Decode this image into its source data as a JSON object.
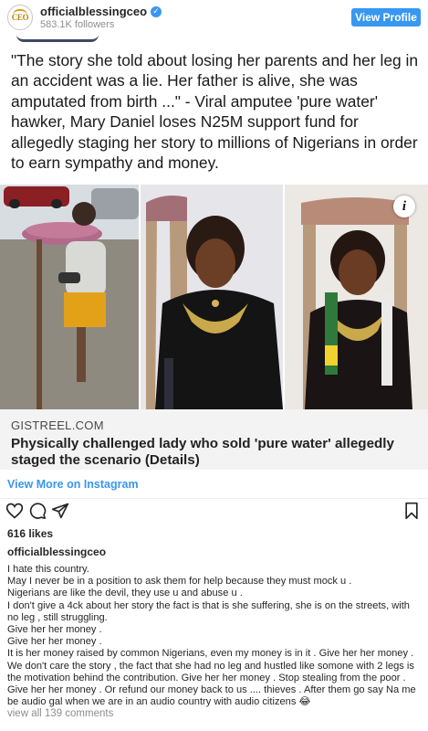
{
  "header": {
    "avatar_text": "CEO",
    "username": "officialblessingceo",
    "verified_mark": "✓",
    "followers": "583.1K followers",
    "view_profile": "View Profile"
  },
  "post": {
    "headline": "\"The story she told about losing her parents and her leg in an accident was a lie. Her father is alive, she was amputated from birth ...\" - Viral amputee 'pure water' hawker, Mary Daniel loses N25M support fund for allegedly staging her story to millions of Nigerians in order to earn sympathy and money.",
    "info_icon_glyph": "i",
    "link": {
      "domain": "GISTREEL.COM",
      "title": "Physically challenged lady who sold 'pure water' allegedly staged the scenario (Details)"
    },
    "view_more": "View More on Instagram"
  },
  "icons": {
    "like": "heart-icon",
    "comment": "comment-bubble-icon",
    "share": "paper-plane-icon",
    "save": "bookmark-icon",
    "info": "info-icon"
  },
  "engagement": {
    "likes": "616 likes",
    "caption_user": "officialblessingceo",
    "caption_lines": [
      "I hate this country.",
      "May I never be in a position to ask them for help because they must mock u .",
      "Nigerians are like the devil, they use u and abuse u .",
      "I don't give a 4ck about her story the fact is that is she suffering, she is on the streets, with no leg , still struggling.",
      "Give her her money .",
      "Give her her money .",
      "It is her money raised by common Nigerians, even my money is in it . Give her her money . We don't care the story , the fact that she had no leg and hustled like somone with 2 legs is the motivation behind the contribution. Give her her money . Stop stealing from the poor . Give her her money . Or refund our money back to us .... thieves . After them go say Na me be audio gal when we are in an audio country with audio citizens 😂"
    ],
    "view_comments": "view all 139 comments"
  },
  "colors": {
    "accent": "#3897f0",
    "text": "#262626",
    "muted": "#8e8e8e",
    "card_bg": "#f3f3f3"
  }
}
